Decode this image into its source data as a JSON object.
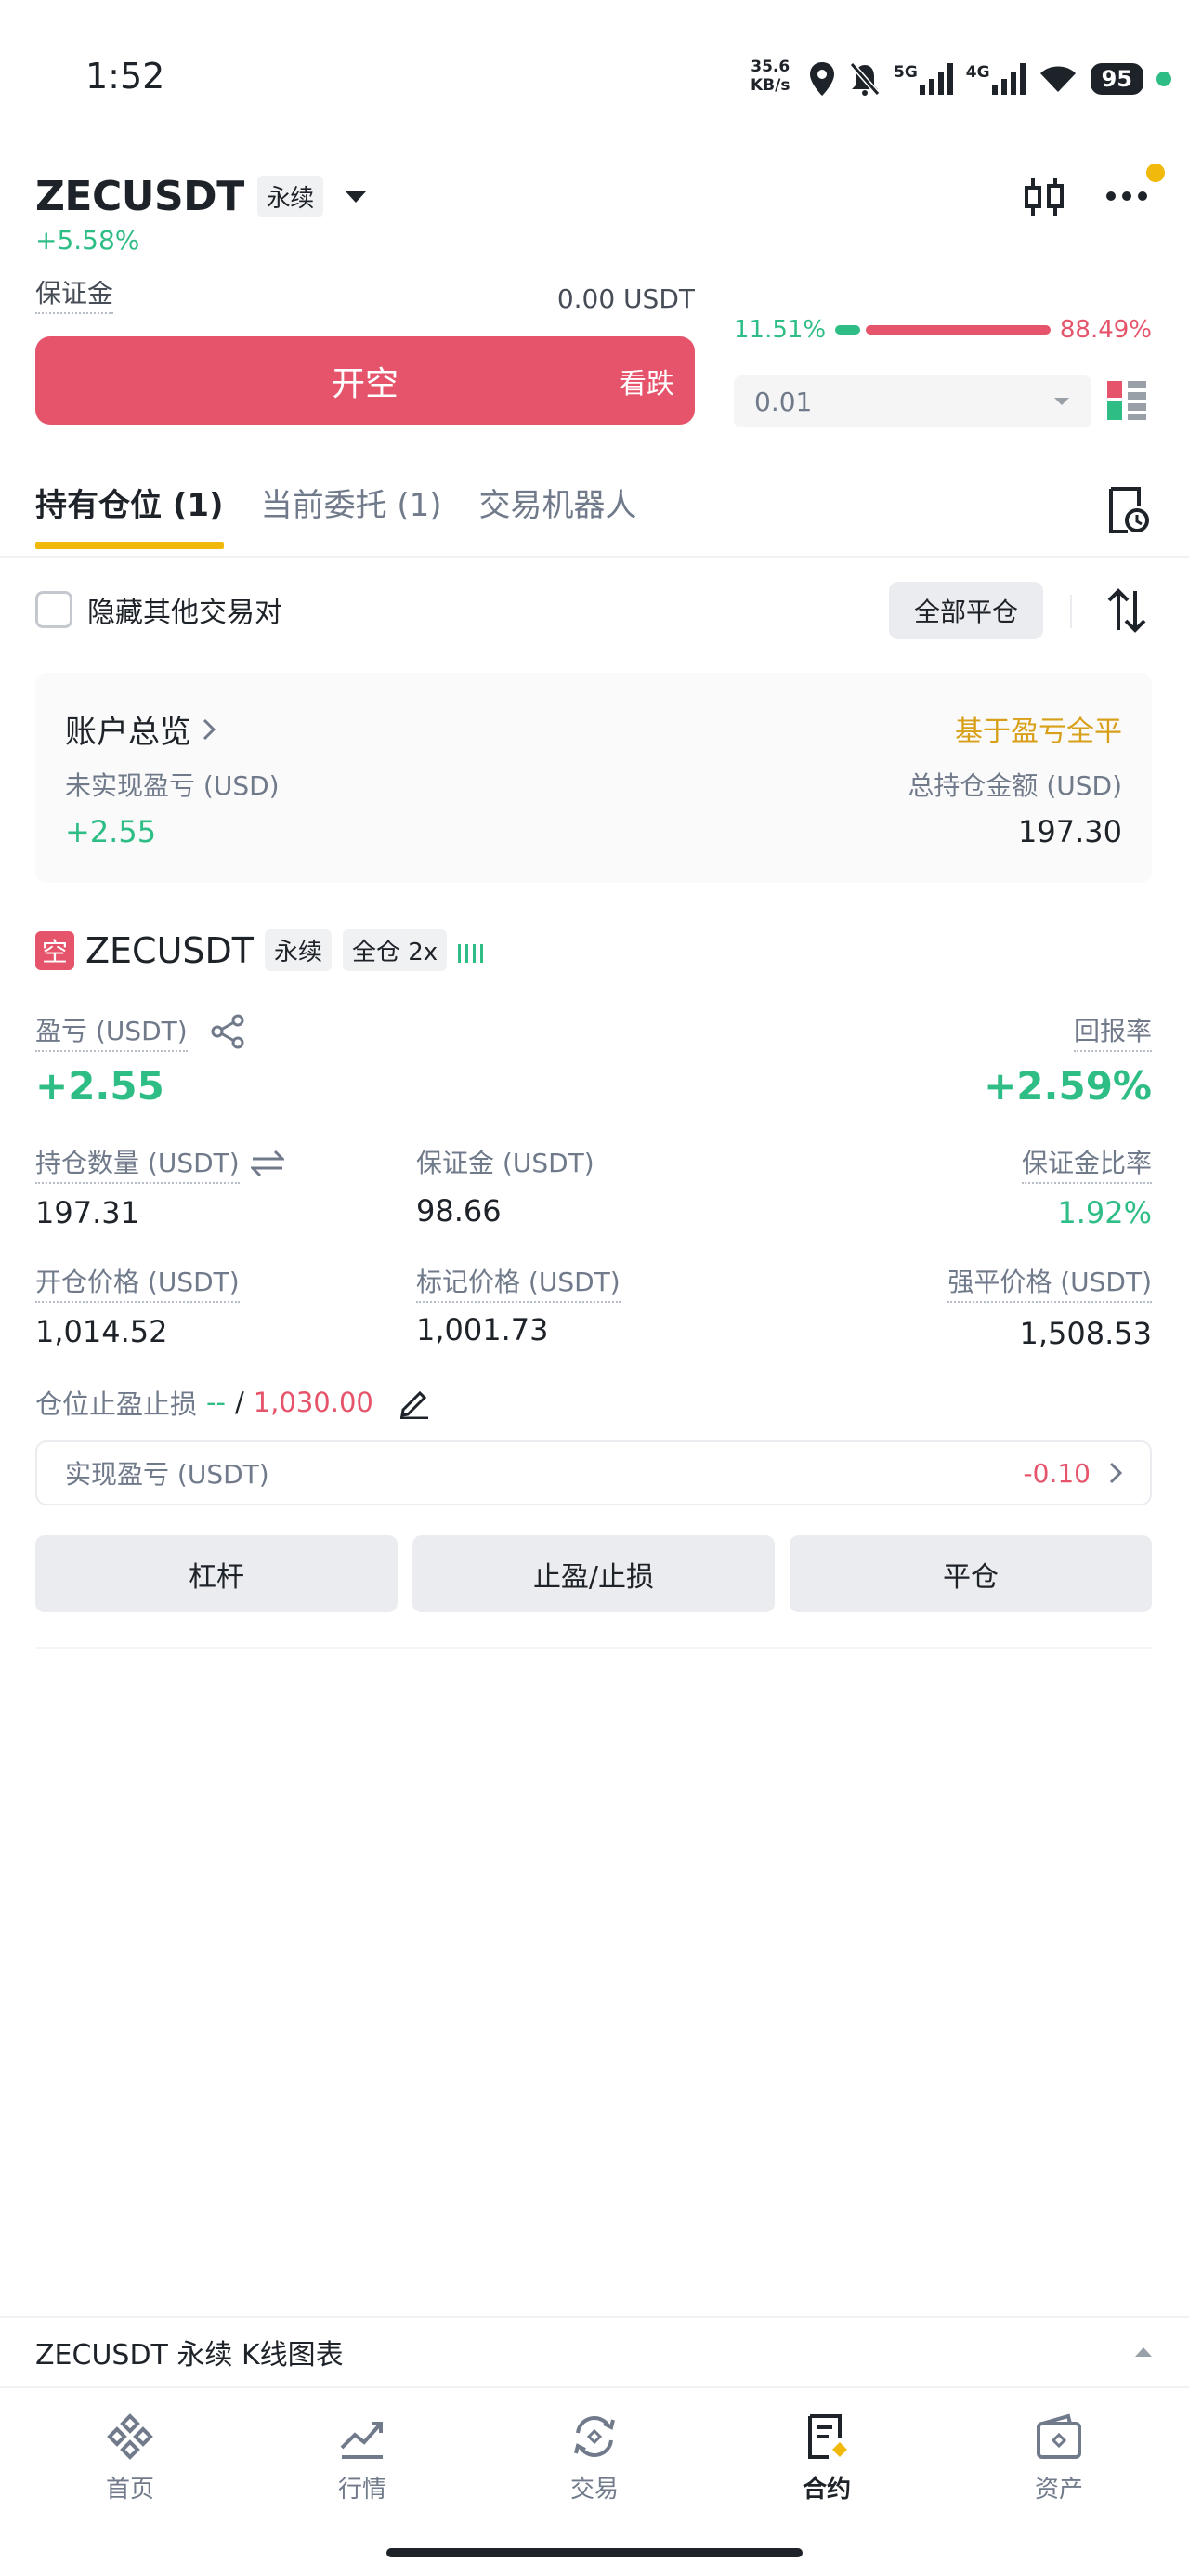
{
  "status_bar": {
    "time": "1:52",
    "net_speed_value": "35.6",
    "net_speed_unit": "KB/s",
    "signal_5g": "5G",
    "signal_4g": "4G",
    "battery": "95"
  },
  "header": {
    "pair": "ZECUSDT",
    "contract_type": "永续",
    "change": "+5.58%"
  },
  "order_panel": {
    "margin_label": "保证金",
    "margin_value": "0.00 USDT",
    "open_short_label": "开空",
    "bearish_label": "看跌",
    "buy_ratio": "11.51%",
    "sell_ratio": "88.49%",
    "buy_ratio_value": 11.51,
    "quantity": "0.01"
  },
  "tabs": [
    {
      "label": "持有仓位 (1)",
      "active": true
    },
    {
      "label": "当前委托 (1)",
      "active": false
    },
    {
      "label": "交易机器人",
      "active": false
    }
  ],
  "filter": {
    "hide_others_label": "隐藏其他交易对",
    "close_all_label": "全部平仓"
  },
  "account": {
    "title": "账户总览",
    "close_by_pnl": "基于盈亏全平",
    "unrealized_label": "未实现盈亏 (USD)",
    "unrealized_value": "+2.55",
    "total_label": "总持仓金额 (USD)",
    "total_value": "197.30"
  },
  "position": {
    "side_badge": "空",
    "pair": "ZECUSDT",
    "contract_type": "永续",
    "margin_mode": "全仓 2x",
    "pnl_label": "盈亏 (USDT)",
    "pnl_value": "+2.55",
    "roe_label": "回报率",
    "roe_value": "+2.59%",
    "size_label": "持仓数量 (USDT)",
    "size_value": "197.31",
    "margin_label": "保证金 (USDT)",
    "margin_value": "98.66",
    "margin_ratio_label": "保证金比率",
    "margin_ratio_value": "1.92%",
    "entry_label": "开仓价格 (USDT)",
    "entry_value": "1,014.52",
    "mark_label": "标记价格 (USDT)",
    "mark_value": "1,001.73",
    "liq_label": "强平价格 (USDT)",
    "liq_value": "1,508.53",
    "tpsl_label": "仓位止盈止损",
    "tp_value": "--",
    "tpsl_separator": "/",
    "sl_value": "1,030.00",
    "realized_label": "实现盈亏 (USDT)",
    "realized_value": "-0.10",
    "btn_leverage": "杠杆",
    "btn_tpsl": "止盈/止损",
    "btn_close": "平仓"
  },
  "kline_bar": {
    "label": "ZECUSDT 永续 K线图表"
  },
  "bottom_nav": [
    {
      "label": "首页",
      "icon": "home-icon"
    },
    {
      "label": "行情",
      "icon": "markets-icon"
    },
    {
      "label": "交易",
      "icon": "trade-icon"
    },
    {
      "label": "合约",
      "icon": "futures-icon",
      "active": true
    },
    {
      "label": "资产",
      "icon": "wallet-icon"
    }
  ],
  "colors": {
    "accent": "#f0b90b",
    "up": "#2ebd85",
    "down": "#e5546a"
  }
}
